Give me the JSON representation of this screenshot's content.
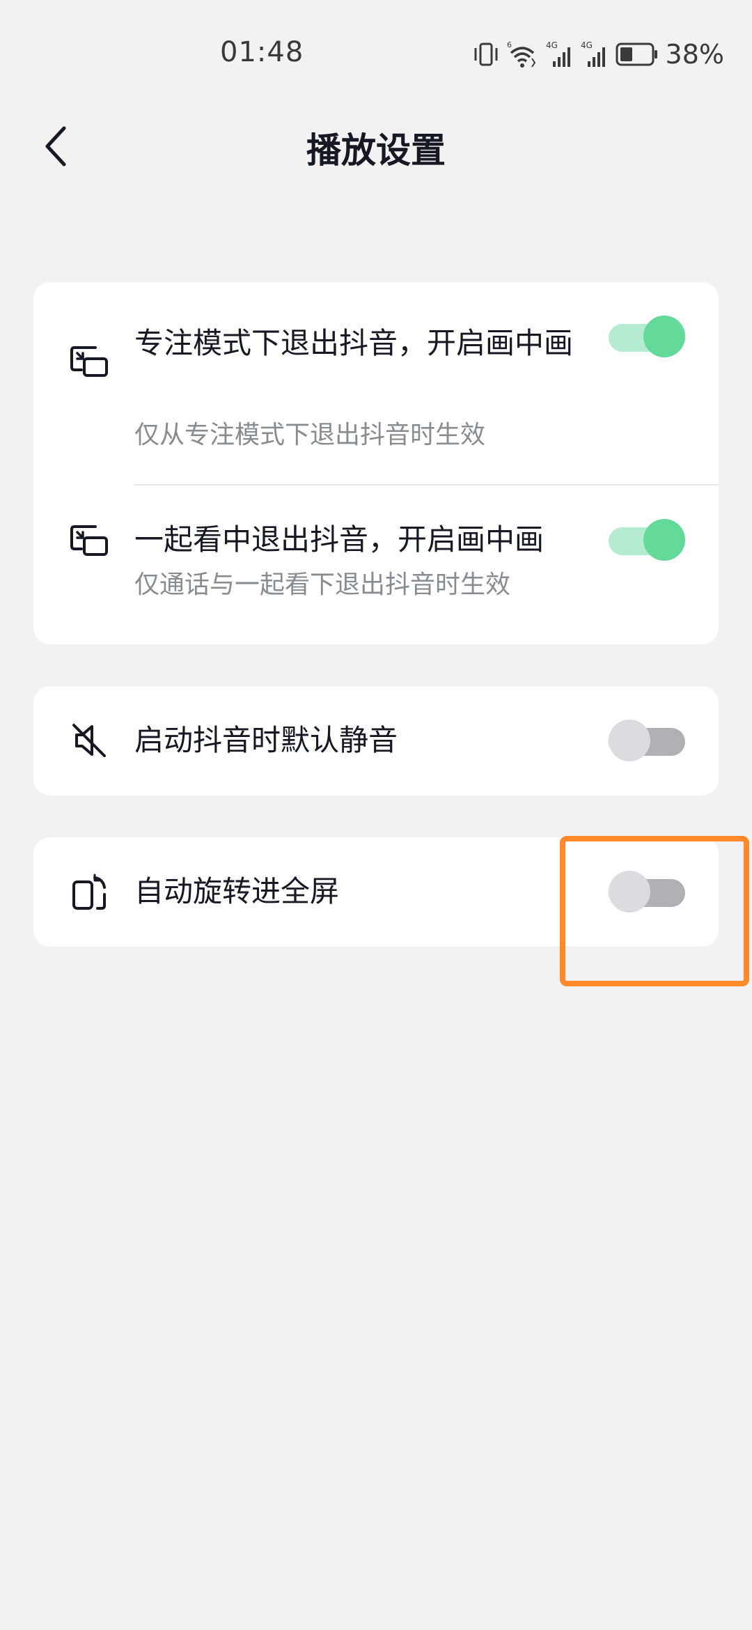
{
  "status_bar": {
    "time": "01:48",
    "battery_percent": "38%",
    "icons": [
      "vibrate-icon",
      "wifi-icon",
      "signal-4g-icon",
      "signal-4g-icon",
      "battery-icon"
    ],
    "signal_labels": [
      "6",
      "4G",
      "4G"
    ]
  },
  "header": {
    "title": "播放设置",
    "back_icon": "chevron-left-icon"
  },
  "sections": {
    "pip_focus": {
      "icon": "pip-icon",
      "title": "专注模式下退出抖音，开启画中画",
      "subtitle": "仅从专注模式下退出抖音时生效",
      "enabled": true
    },
    "pip_watch_together": {
      "icon": "pip-icon",
      "title": "一起看中退出抖音，开启画中画",
      "subtitle": "仅通话与一起看下退出抖音时生效",
      "enabled": true
    },
    "mute_on_launch": {
      "icon": "mute-icon",
      "title": "启动抖音时默认静音",
      "enabled": false
    },
    "auto_rotate": {
      "icon": "rotate-screen-icon",
      "title": "自动旋转进全屏",
      "enabled": false
    }
  },
  "colors": {
    "background": "#f2f2f2",
    "card": "#ffffff",
    "toggle_on_track": "#b5ebd0",
    "toggle_on_knob": "#63d99a",
    "toggle_off_track": "#b0b0b5",
    "toggle_off_knob": "#dcdce0",
    "highlight": "#ff8a2b"
  }
}
